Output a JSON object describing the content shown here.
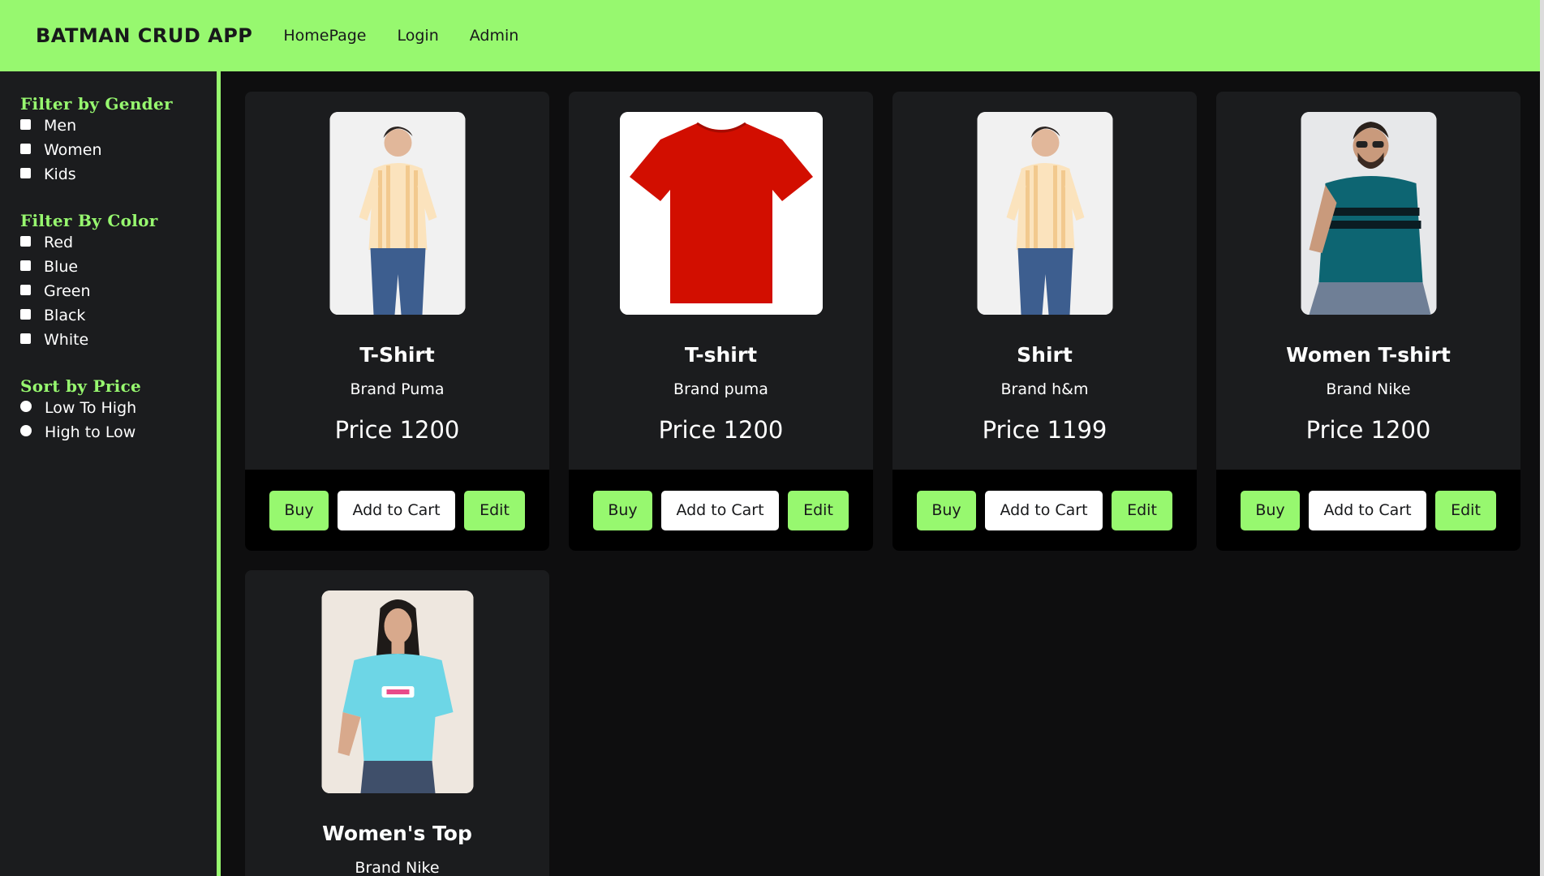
{
  "navbar": {
    "brand": "BATMAN CRUD APP",
    "links": [
      "HomePage",
      "Login",
      "Admin"
    ],
    "bg_color": "#97f86f"
  },
  "sidebar": {
    "gender": {
      "title": "Filter by Gender",
      "options": [
        "Men",
        "Women",
        "Kids"
      ]
    },
    "color": {
      "title": "Filter By Color",
      "options": [
        "Red",
        "Blue",
        "Green",
        "Black",
        "White"
      ]
    },
    "price": {
      "title": "Sort by Price",
      "options": [
        "Low To High",
        "High to Low"
      ]
    }
  },
  "buttons": {
    "buy": "Buy",
    "cart": "Add to Cart",
    "edit": "Edit"
  },
  "products": [
    {
      "title": "T-Shirt",
      "brand": "Brand Puma",
      "price": "Price 1200",
      "image": "man-striped-shirt"
    },
    {
      "title": "T-shirt",
      "brand": "Brand puma",
      "price": "Price 1200",
      "image": "red-tshirt"
    },
    {
      "title": "Shirt",
      "brand": "Brand h&m",
      "price": "Price 1199",
      "image": "man-striped-shirt"
    },
    {
      "title": "Women T-shirt",
      "brand": "Brand Nike",
      "price": "Price 1200",
      "image": "man-teal-tshirt"
    },
    {
      "title": "Women's Top",
      "brand": "Brand Nike",
      "price": "",
      "image": "woman-cyan-top"
    }
  ]
}
